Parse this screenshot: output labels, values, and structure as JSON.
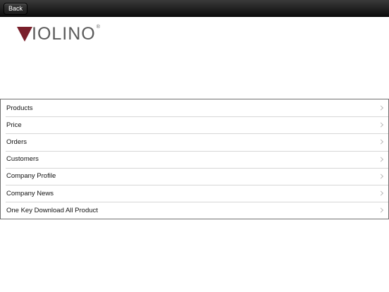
{
  "navbar": {
    "back_label": "Back"
  },
  "logo": {
    "text": "IOLINO",
    "registered": "®",
    "triangle_color": "#7a1f2b"
  },
  "menu": {
    "items": [
      {
        "label": "Products"
      },
      {
        "label": "Price"
      },
      {
        "label": "Orders"
      },
      {
        "label": "Customers"
      },
      {
        "label": "Company Profile"
      },
      {
        "label": "Company News"
      },
      {
        "label": "One Key Download All Product"
      }
    ]
  }
}
